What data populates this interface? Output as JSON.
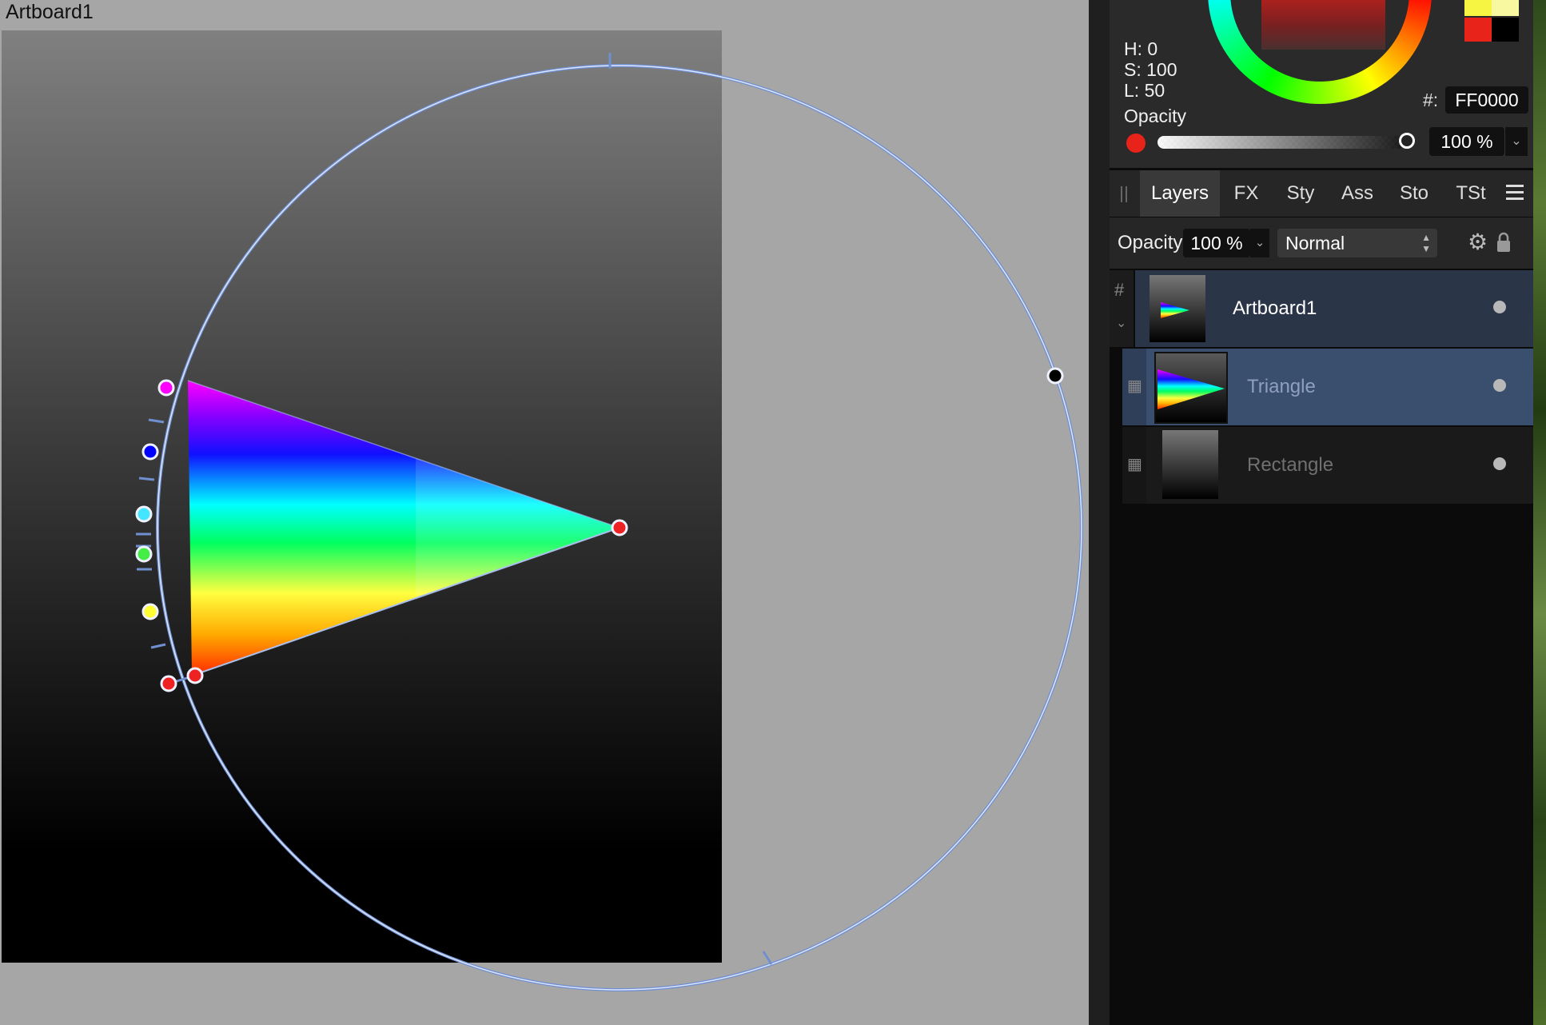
{
  "canvas": {
    "artboard_label": "Artboard1"
  },
  "color_panel": {
    "h_label": "H:",
    "h_value": "0",
    "s_label": "S:",
    "s_value": "100",
    "l_label": "L:",
    "l_value": "50",
    "hex_label": "#:",
    "hex_value": "FF0000",
    "opacity_heading": "Opacity",
    "opacity_value": "100 %",
    "opacity_fraction": 1.0,
    "current_color": "#FF0000",
    "swatches": [
      "#f5f542",
      "#f8f8a0",
      "#e8231a",
      "#000000"
    ]
  },
  "tabs": [
    {
      "label": "Layers",
      "active": true
    },
    {
      "label": "FX",
      "active": false
    },
    {
      "label": "Sty",
      "active": false
    },
    {
      "label": "Ass",
      "active": false
    },
    {
      "label": "Sto",
      "active": false
    },
    {
      "label": "TSt",
      "active": false
    }
  ],
  "layer_toolbar": {
    "opacity_label": "Opacity:",
    "opacity_value": "100 %",
    "blend_mode": "Normal"
  },
  "layers": [
    {
      "name": "Artboard1",
      "type": "artboard",
      "selected": false
    },
    {
      "name": "Triangle",
      "type": "shape",
      "selected": true
    },
    {
      "name": "Rectangle",
      "type": "shape",
      "selected": false
    }
  ],
  "gradient_stops": [
    "#ff00ff",
    "#0000ff",
    "#00ffff",
    "#00ff00",
    "#ffff00",
    "#ff0000"
  ],
  "colors": {
    "accent": "#6f8fd0",
    "panel_bg": "#0b0b0b",
    "canvas_bg": "#a6a6a6",
    "selected_row": "#3a4e6e",
    "artboard_row": "#2a3547"
  }
}
